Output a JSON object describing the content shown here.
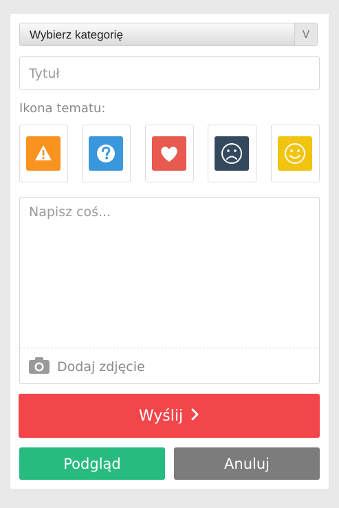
{
  "form": {
    "category_select": {
      "label": "Wybierz kategorię",
      "arrow": "V"
    },
    "title_input": {
      "placeholder": "Tytuł"
    },
    "icon_section_label": "Ikona tematu:",
    "topic_icons": [
      {
        "name": "warning-icon",
        "color": "#f7931e"
      },
      {
        "name": "question-icon",
        "color": "#3b97dc"
      },
      {
        "name": "heart-icon",
        "color": "#e85a4f"
      },
      {
        "name": "sad-face-icon",
        "color": "#34495e"
      },
      {
        "name": "smile-face-icon",
        "color": "#f1c40f"
      }
    ],
    "message_textarea": {
      "placeholder": "Napisz coś..."
    },
    "add_photo": {
      "icon": "camera-icon",
      "label": "Dodaj zdjęcie"
    }
  },
  "actions": {
    "send_label": "Wyślij",
    "send_icon": "chevron-right-icon",
    "preview_label": "Podgląd",
    "cancel_label": "Anuluj"
  },
  "colors": {
    "send": "#f2464b",
    "preview": "#27bb7f",
    "cancel": "#7c7c7c"
  }
}
